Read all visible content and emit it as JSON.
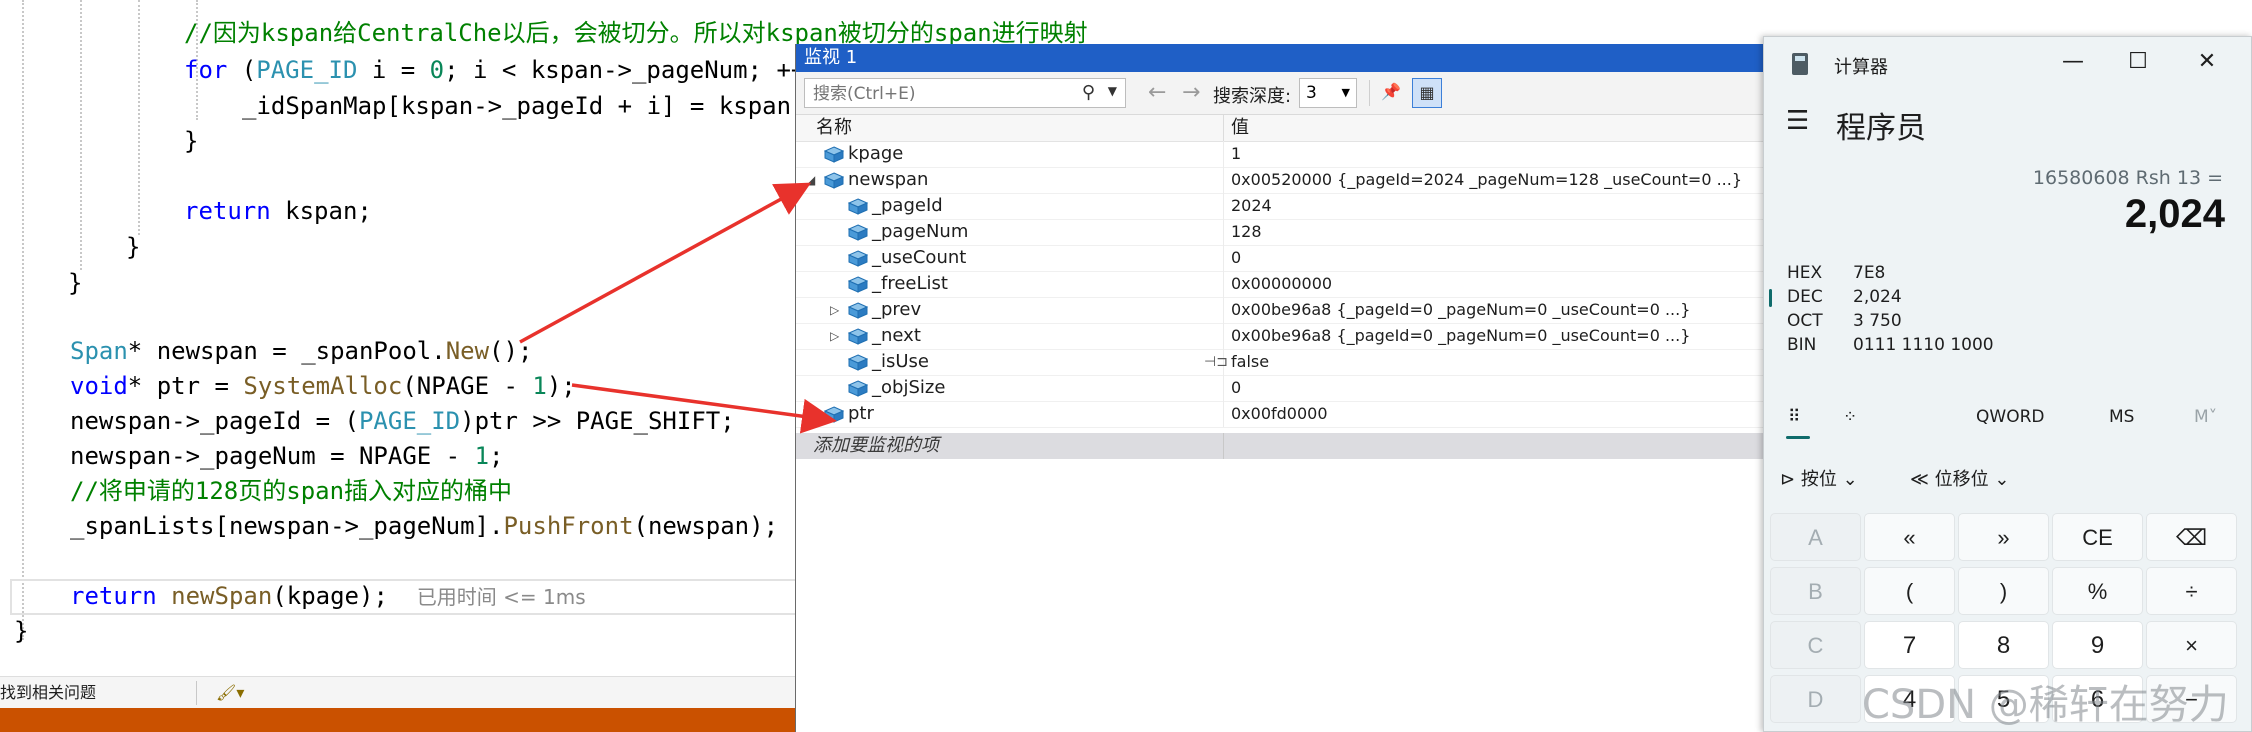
{
  "editor": {
    "lines": [
      [
        {
          "t": "//因为kspan给CentralChe以后，会被切分。所以对kspan被切分的span进行映射",
          "c": "cmt"
        }
      ],
      [
        {
          "t": "for",
          "c": "kw"
        },
        {
          "t": " (",
          "c": ""
        },
        {
          "t": "PAGE_ID",
          "c": "ty"
        },
        {
          "t": " i = ",
          "c": ""
        },
        {
          "t": "0",
          "c": "num"
        },
        {
          "t": "; i < kspan->_pageNum; ++",
          "c": ""
        }
      ],
      [
        {
          "t": "_idSpanMap[kspan->_pageId + i] = kspan;",
          "c": ""
        }
      ],
      [
        {
          "t": "}",
          "c": ""
        }
      ],
      [],
      [
        {
          "t": "return",
          "c": "kw"
        },
        {
          "t": " kspan;",
          "c": ""
        }
      ],
      [
        {
          "t": "}",
          "c": ""
        }
      ],
      [
        {
          "t": "}",
          "c": ""
        }
      ],
      [],
      [
        {
          "t": "Span",
          "c": "ty"
        },
        {
          "t": "* newspan = _spanPool.",
          "c": ""
        },
        {
          "t": "New",
          "c": "fn"
        },
        {
          "t": "();",
          "c": ""
        }
      ],
      [
        {
          "t": "void",
          "c": "kw"
        },
        {
          "t": "* ptr = ",
          "c": ""
        },
        {
          "t": "SystemAlloc",
          "c": "fn"
        },
        {
          "t": "(NPAGE - ",
          "c": ""
        },
        {
          "t": "1",
          "c": "num"
        },
        {
          "t": ");",
          "c": ""
        }
      ],
      [
        {
          "t": "newspan->_pageId = (",
          "c": ""
        },
        {
          "t": "PAGE_ID",
          "c": "ty"
        },
        {
          "t": ")ptr >> PAGE_SHIFT;",
          "c": ""
        }
      ],
      [
        {
          "t": "newspan->_pageNum = NPAGE - ",
          "c": ""
        },
        {
          "t": "1",
          "c": "num"
        },
        {
          "t": ";",
          "c": ""
        }
      ],
      [
        {
          "t": "//将申请的128页的span插入对应的桶中",
          "c": "cmt"
        }
      ],
      [
        {
          "t": "_spanLists[newspan->_pageNum].",
          "c": ""
        },
        {
          "t": "PushFront",
          "c": "fn"
        },
        {
          "t": "(newspan);",
          "c": ""
        }
      ],
      [],
      [
        {
          "t": "return",
          "c": "kw"
        },
        {
          "t": " ",
          "c": ""
        },
        {
          "t": "newSpan",
          "c": "fn"
        },
        {
          "t": "(kpage);  ",
          "c": ""
        },
        {
          "t": "已用时间 <= 1ms",
          "c": "hint"
        }
      ],
      [
        {
          "t": "}",
          "c": ""
        }
      ]
    ],
    "status_text": "找到相关问题"
  },
  "watch": {
    "title": "监视 1",
    "search_placeholder": "搜索(Ctrl+E)",
    "depth_label": "搜索深度:",
    "depth_value": "3",
    "col_name": "名称",
    "col_value": "值",
    "rows": [
      {
        "name": "kpage",
        "value": "1",
        "level": 0,
        "expander": ""
      },
      {
        "name": "newspan",
        "value": "0x00520000 {_pageId=2024 _pageNum=128 _useCount=0 ...}",
        "level": 0,
        "expander": "◢"
      },
      {
        "name": "_pageId",
        "value": "2024",
        "level": 1,
        "expander": ""
      },
      {
        "name": "_pageNum",
        "value": "128",
        "level": 1,
        "expander": ""
      },
      {
        "name": "_useCount",
        "value": "0",
        "level": 1,
        "expander": ""
      },
      {
        "name": "_freeList",
        "value": "0x00000000",
        "level": 1,
        "expander": ""
      },
      {
        "name": "_prev",
        "value": "0x00be96a8 {_pageId=0 _pageNum=0 _useCount=0 ...}",
        "level": 1,
        "expander": "▷"
      },
      {
        "name": "_next",
        "value": "0x00be96a8 {_pageId=0 _pageNum=0 _useCount=0 ...}",
        "level": 1,
        "expander": "▷"
      },
      {
        "name": "_isUse",
        "value": "false",
        "level": 1,
        "expander": "",
        "pinned": true
      },
      {
        "name": "_objSize",
        "value": "0",
        "level": 1,
        "expander": ""
      },
      {
        "name": "ptr",
        "value": "0x00fd0000",
        "level": 0,
        "expander": ""
      }
    ],
    "add_item": "添加要监视的项"
  },
  "calculator": {
    "title": "计算器",
    "mode": "程序员",
    "expression": "16580608 Rsh 13 =",
    "result": "2,024",
    "radix": [
      {
        "label": "HEX",
        "value": "7E8",
        "active": false
      },
      {
        "label": "DEC",
        "value": "2,024",
        "active": true
      },
      {
        "label": "OCT",
        "value": "3 750",
        "active": false
      },
      {
        "label": "BIN",
        "value": "0111 1110 1000",
        "active": false
      }
    ],
    "tabs": {
      "word_size": "QWORD",
      "ms": "MS",
      "mplus": "M˅"
    },
    "ops": {
      "bitwise": "按位",
      "bitshift": "位移位"
    },
    "keys": [
      [
        "A",
        "«",
        "»",
        "CE",
        "⌫"
      ],
      [
        "B",
        "(",
        ")",
        "%",
        "÷"
      ],
      [
        "C",
        "7",
        "8",
        "9",
        "×"
      ],
      [
        "D",
        "4",
        "5",
        "6",
        "−"
      ]
    ]
  },
  "watermark": "CSDN @稀轩在努力"
}
